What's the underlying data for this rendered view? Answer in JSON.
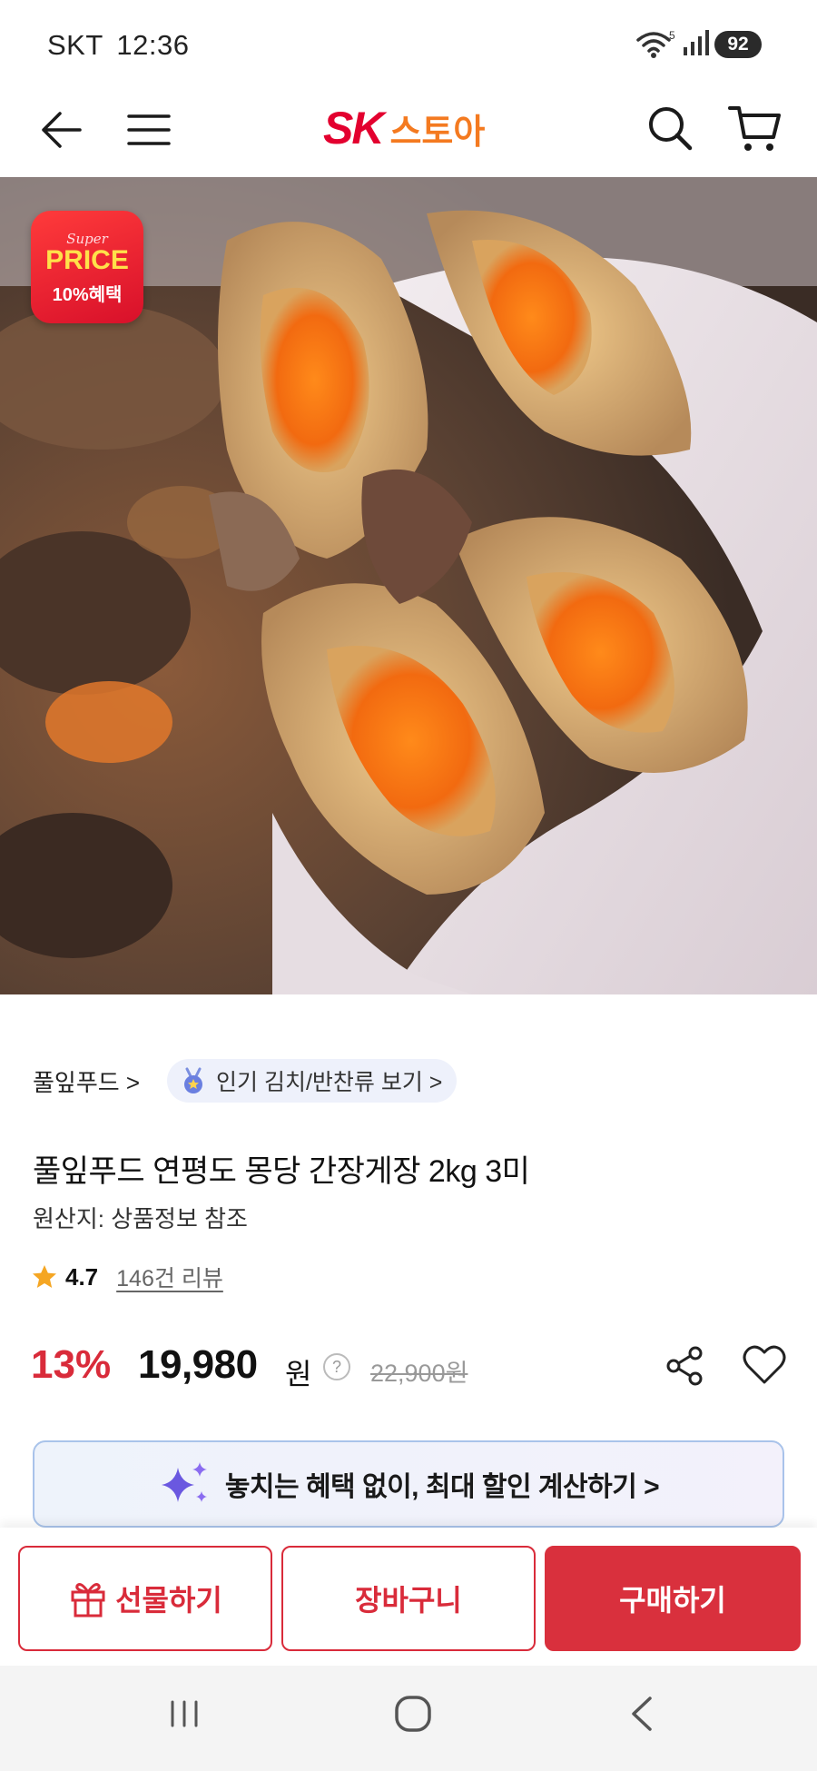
{
  "status_bar": {
    "carrier": "SKT",
    "time": "12:36",
    "battery": "92",
    "network_label": "5"
  },
  "header": {
    "logo_brand": "SK",
    "logo_store": "스토아",
    "brand_color": "#e3002f"
  },
  "hero": {
    "badge_super": "Super",
    "badge_price": "PRICE",
    "badge_benefit": "10%혜택"
  },
  "breadcrumb": {
    "seller": "풀잎푸드 >",
    "category_chip": "인기 김치/반찬류 보기 >"
  },
  "product": {
    "title": "풀잎푸드 연평도 몽당 간장게장 2kg 3미",
    "origin": "원산지: 상품정보 참조",
    "rating": "4.7",
    "review_count": "146건 리뷰",
    "discount_rate": "13%",
    "sale_price": "19,980",
    "currency": "원",
    "help_mark": "?",
    "original_price": "22,900원"
  },
  "coupon_banner": {
    "text": "놓치는 혜택 없이, 최대 할인 계산하기 >"
  },
  "actions": {
    "gift": "선물하기",
    "cart": "장바구니",
    "buy": "구매하기",
    "accent": "#d92b3a"
  }
}
